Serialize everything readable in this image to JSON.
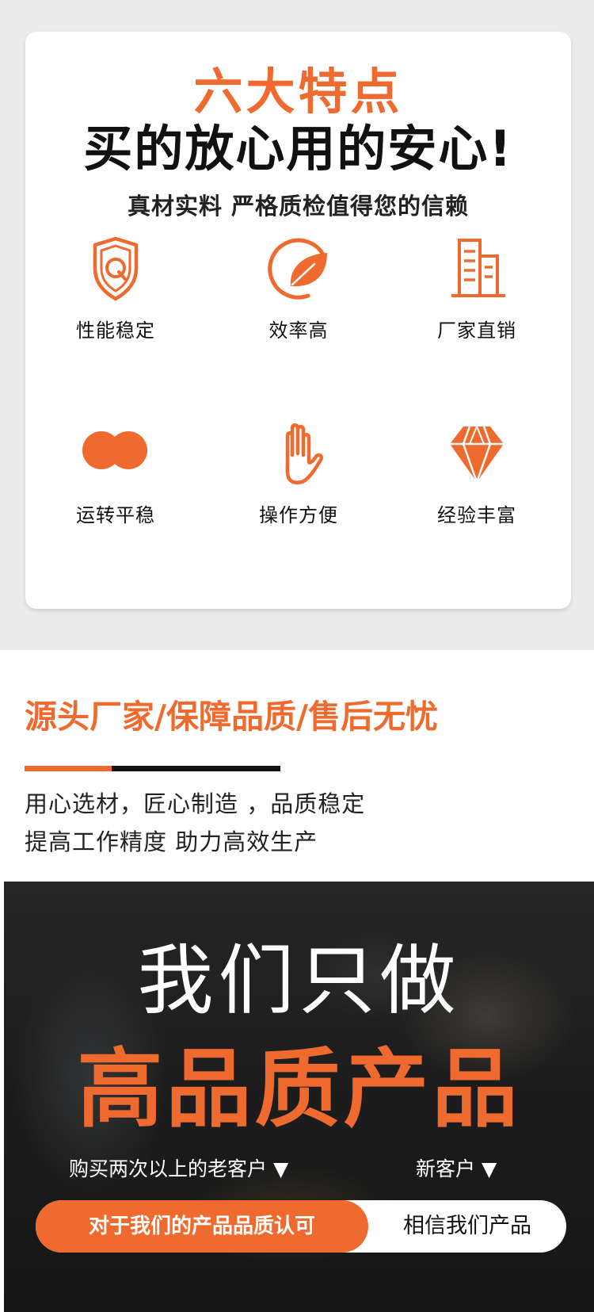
{
  "colors": {
    "accent": "#ef6a2e",
    "text": "#111111",
    "panel_bg": "#ececec"
  },
  "features_card": {
    "title": "六大特点",
    "headline": "买的放心用的安心!",
    "subtitle": "真材实料 严格质检值得您的信赖",
    "items": [
      {
        "label": "性能稳定",
        "icon": "shield-q-icon"
      },
      {
        "label": "效率高",
        "icon": "leaf-circle-icon"
      },
      {
        "label": "厂家直销",
        "icon": "buildings-icon"
      },
      {
        "label": "运转平稳",
        "icon": "double-circle-icon"
      },
      {
        "label": "操作方便",
        "icon": "hand-icon"
      },
      {
        "label": "经验丰富",
        "icon": "diamond-icon"
      }
    ]
  },
  "quality_section": {
    "title": "源头厂家/保障品质/售后无忧",
    "line1": "用心选材，匠心制造 ，品质稳定",
    "line2": "提高工作精度 助力高效生产"
  },
  "banner": {
    "line1": "我们只做",
    "line2": "高品质产品",
    "label_left": "购买两次以上的老客户 ▼",
    "label_right": "新客户 ▼",
    "pill_left": "对于我们的产品品质认可",
    "pill_right": "相信我们产品"
  }
}
